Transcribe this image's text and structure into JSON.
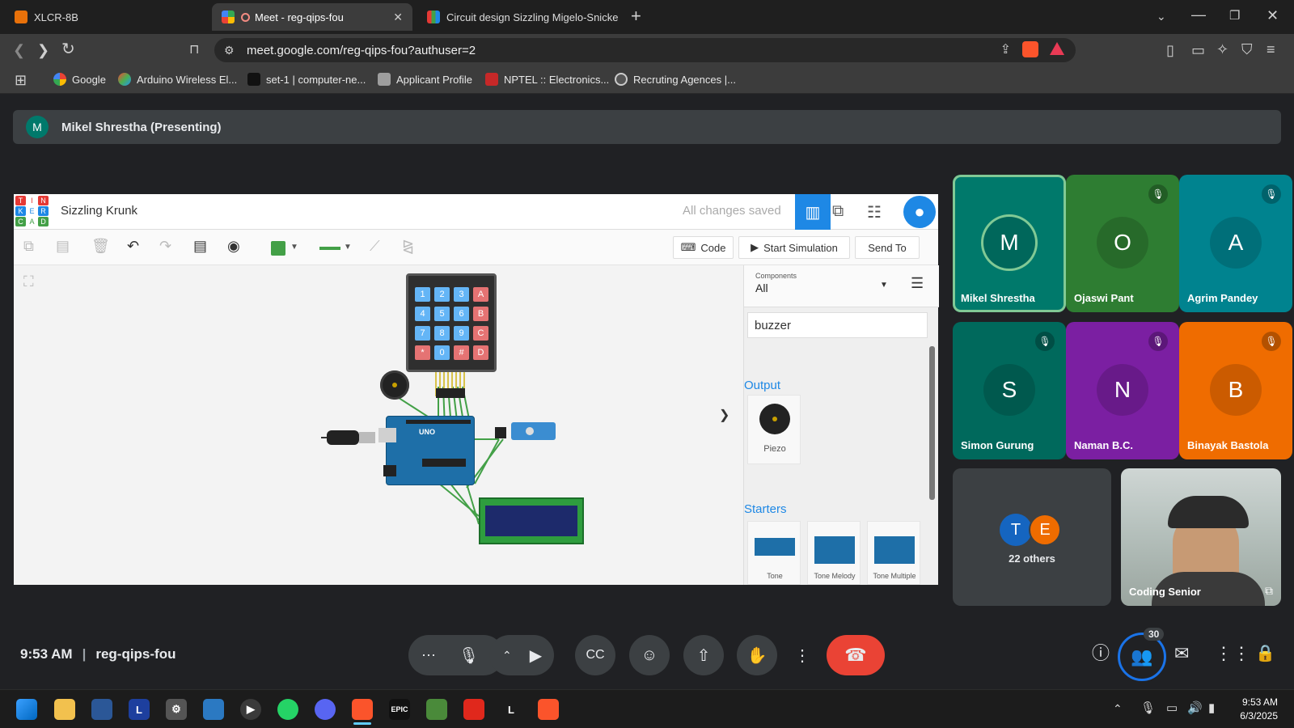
{
  "browser": {
    "tabs": [
      {
        "title": "XLCR-8B"
      },
      {
        "title": "Meet - reg-qips-fou"
      },
      {
        "title": "Circuit design Sizzling Migelo-Snicke"
      }
    ],
    "url": "meet.google.com/reg-qips-fou?authuser=2",
    "bookmarks": [
      "Google",
      "Arduino Wireless El...",
      "set-1 | computer-ne...",
      "Applicant Profile",
      "NPTEL :: Electronics...",
      "Recruting Agences |..."
    ]
  },
  "meet": {
    "presenting_initial": "M",
    "presenting_label": "Mikel Shrestha (Presenting)",
    "participants": [
      {
        "initial": "M",
        "name": "Mikel Shrestha",
        "color": "#00796b",
        "muted": false
      },
      {
        "initial": "O",
        "name": "Ojaswi Pant",
        "color": "#2e7d32",
        "muted": true
      },
      {
        "initial": "A",
        "name": "Agrim Pandey",
        "color": "#00838f",
        "muted": true
      },
      {
        "initial": "S",
        "name": "Simon Gurung",
        "color": "#00695c",
        "muted": true
      },
      {
        "initial": "N",
        "name": "Naman B.C.",
        "color": "#7b1fa2",
        "muted": true
      },
      {
        "initial": "B",
        "name": "Binayak Bastola",
        "color": "#ef6c00",
        "muted": true
      }
    ],
    "others": {
      "initials": [
        "T",
        "E"
      ],
      "label": "22 others"
    },
    "self_name": "Coding Senior",
    "time": "9:53 AM",
    "separator": "|",
    "meeting_code": "reg-qips-fou",
    "people_count": "30",
    "accent": "#1a73e8",
    "end_call_color": "#ea4335"
  },
  "tinkercad": {
    "logo_letters": [
      "T",
      "I",
      "N",
      "K",
      "E",
      "R",
      "C",
      "A",
      "D"
    ],
    "project_title": "Sizzling Krunk",
    "save_status": "All changes saved",
    "code_label": "Code",
    "start_sim_label": "Start Simulation",
    "send_to_label": "Send To",
    "components_label": "Components",
    "components_value": "All",
    "search_value": "buzzer",
    "output_heading": "Output",
    "piezo_label": "Piezo",
    "starters_heading": "Starters",
    "starters": [
      "Tone",
      "Tone Melody",
      "Tone Multiple"
    ],
    "keypad_keys": [
      "1",
      "2",
      "3",
      "A",
      "4",
      "5",
      "6",
      "B",
      "7",
      "8",
      "9",
      "C",
      "*",
      "0",
      "#",
      "D"
    ],
    "board_label": "UNO",
    "collapse_glyph": "❯"
  },
  "taskbar": {
    "time": "9:53 AM",
    "date": "6/3/2025"
  }
}
